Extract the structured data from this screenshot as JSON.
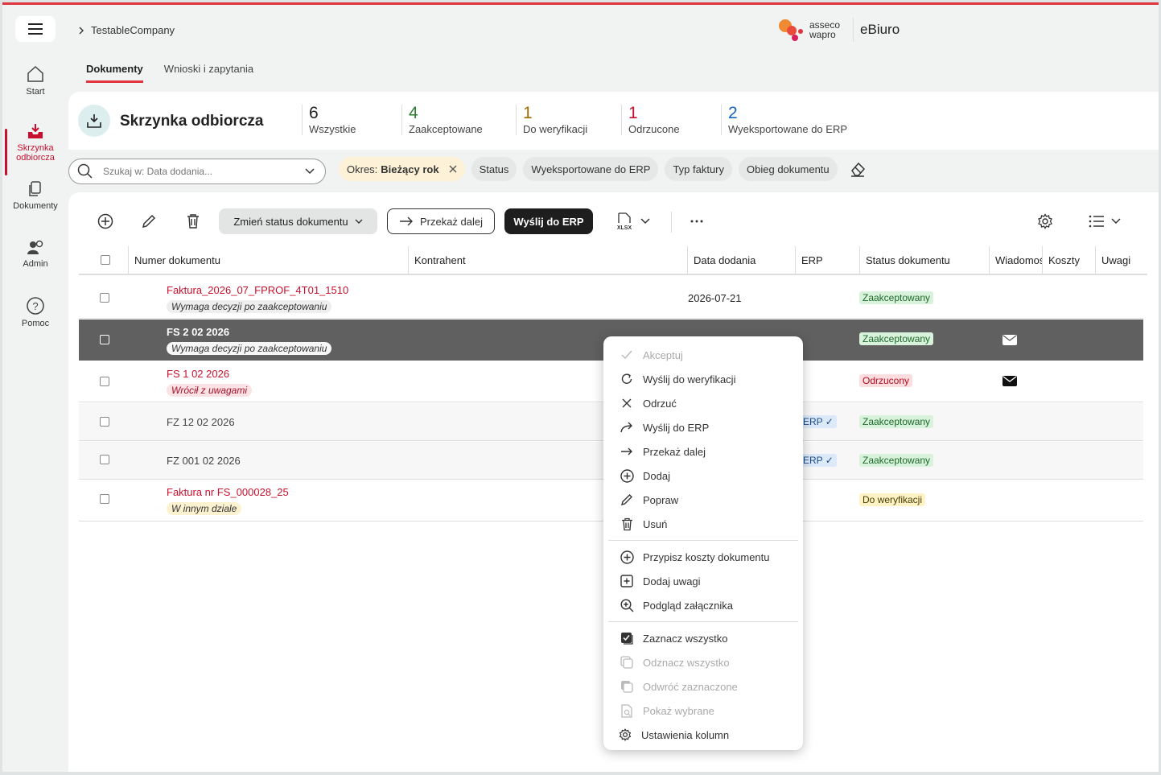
{
  "header": {
    "company": "TestableCompany",
    "brand_line1": "asseco",
    "brand_line2": "wapro",
    "app_name": "eBiuro"
  },
  "sidebar": {
    "items": [
      {
        "label": "Start",
        "icon": "home-icon"
      },
      {
        "label": "Skrzynka odbiorcza",
        "icon": "inbox-icon"
      },
      {
        "label": "Dokumenty",
        "icon": "documents-icon"
      },
      {
        "label": "Admin",
        "icon": "admin-icon"
      },
      {
        "label": "Pomoc",
        "icon": "help-icon"
      }
    ]
  },
  "tabs": [
    {
      "label": "Dokumenty"
    },
    {
      "label": "Wnioski i zapytania"
    }
  ],
  "inbox": {
    "title": "Skrzynka odbiorcza",
    "stats": [
      {
        "count": "6",
        "label": "Wszystkie",
        "color": "#222222"
      },
      {
        "count": "4",
        "label": "Zaakceptowane",
        "color": "#2e7d32"
      },
      {
        "count": "1",
        "label": "Do weryfikacji",
        "color": "#a36b00"
      },
      {
        "count": "1",
        "label": "Odrzucone",
        "color": "#c8102e"
      },
      {
        "count": "2",
        "label": "Wyeksportowane do ERP",
        "color": "#1565c0"
      }
    ]
  },
  "filters": {
    "search_placeholder": "Szukaj w: Data dodania...",
    "period_label": "Okres:",
    "period_value": "Bieżący rok",
    "chips": [
      "Status",
      "Wyeksportowane do ERP",
      "Typ faktury",
      "Obieg dokumentu"
    ]
  },
  "toolbar": {
    "change_status": "Zmień status dokumentu",
    "forward": "Przekaż dalej",
    "send_erp": "Wyślij do ERP",
    "export_format": "XLSX"
  },
  "table": {
    "columns": [
      "Numer dokumentu",
      "Kontrahent",
      "Data dodania",
      "ERP",
      "Status dokumentu",
      "Wiadomości",
      "Koszty",
      "Uwagi"
    ],
    "rows": [
      {
        "number": "Faktura_2026_07_FPROF_4T01_1510",
        "tag": "Wymaga decyzji po zaakceptowaniu",
        "date": "2026-07-21",
        "erp": "",
        "status": "Zaakceptowany"
      },
      {
        "number": "FS 2 02 2026",
        "tag": "Wymaga decyzji po zaakceptowaniu",
        "date": "",
        "erp": "",
        "status": "Zaakceptowany"
      },
      {
        "number": "FS 1 02 2026",
        "tag": "Wrócił z uwagami",
        "date": "",
        "erp": "",
        "status": "Odrzucony"
      },
      {
        "number": "FZ 12 02 2026",
        "tag": "",
        "date": "",
        "erp": "ERP ✓",
        "status": "Zaakceptowany"
      },
      {
        "number": "FZ 001 02 2026",
        "tag": "",
        "date": "",
        "erp": "ERP ✓",
        "status": "Zaakceptowany"
      },
      {
        "number": "Faktura nr FS_000028_25",
        "tag": "W innym dziale",
        "date": "",
        "erp": "",
        "status": "Do weryfikacji"
      }
    ]
  },
  "context_menu": {
    "group1": [
      {
        "label": "Akceptuj",
        "icon": "check-icon",
        "disabled": true
      },
      {
        "label": "Wyślij do weryfikacji",
        "icon": "refresh-icon",
        "disabled": false
      },
      {
        "label": "Odrzuć",
        "icon": "close-icon",
        "disabled": false
      },
      {
        "label": "Wyślij do ERP",
        "icon": "share-arrow-icon",
        "disabled": false
      },
      {
        "label": "Przekaż dalej",
        "icon": "arrow-right-icon",
        "disabled": false
      },
      {
        "label": "Dodaj",
        "icon": "plus-circle-icon",
        "disabled": false
      },
      {
        "label": "Popraw",
        "icon": "pencil-icon",
        "disabled": false
      },
      {
        "label": "Usuń",
        "icon": "trash-icon",
        "disabled": false
      }
    ],
    "group2": [
      {
        "label": "Przypisz koszty dokumentu",
        "icon": "plus-circle-icon",
        "disabled": false
      },
      {
        "label": "Dodaj uwagi",
        "icon": "plus-square-icon",
        "disabled": false
      },
      {
        "label": "Podgląd załącznika",
        "icon": "zoom-in-icon",
        "disabled": false
      }
    ],
    "group3": [
      {
        "label": "Zaznacz wszystko",
        "icon": "select-all-icon",
        "disabled": false
      },
      {
        "label": "Odznacz wszystko",
        "icon": "deselect-all-icon",
        "disabled": true
      },
      {
        "label": "Odwróć zaznaczone",
        "icon": "invert-selection-icon",
        "disabled": true
      },
      {
        "label": "Pokaż wybrane",
        "icon": "show-selected-icon",
        "disabled": true
      },
      {
        "label": "Ustawienia kolumn",
        "icon": "gear-icon",
        "disabled": false
      }
    ]
  }
}
